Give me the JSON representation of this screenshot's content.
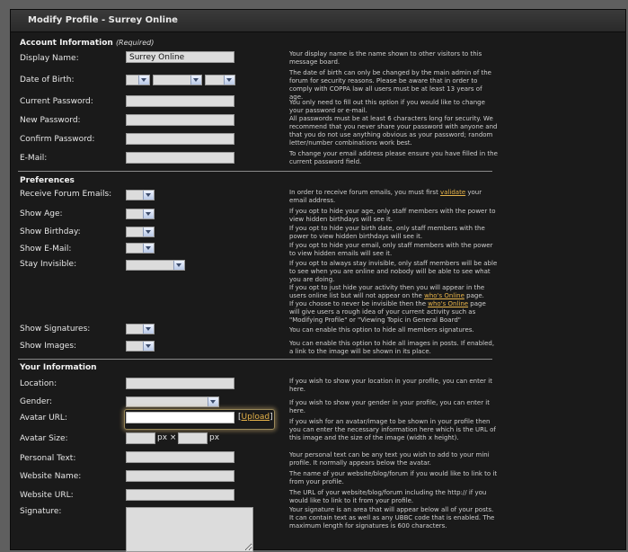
{
  "window": {
    "title": "Modify Profile - Surrey Online"
  },
  "sections": {
    "account": {
      "title": "Account Information",
      "note": "(Required)"
    },
    "preferences": {
      "title": "Preferences"
    },
    "info": {
      "title": "Your Information"
    }
  },
  "account": {
    "display_name": {
      "label": "Display Name:",
      "value": "Surrey Online",
      "help": "Your display name is the name shown to other visitors to this message board."
    },
    "dob": {
      "label": "Date of Birth:",
      "help": "The date of birth can only be changed by the main admin of the forum for security reasons. Please be aware that in order to comply with COPPA law all users must be at least 13 years of age."
    },
    "current_password": {
      "label": "Current Password:",
      "help": "You only need to fill out this option if you would like to change your password or e-mail."
    },
    "new_password": {
      "label": "New Password:",
      "help": "All passwords must be at least 6 characters long for security. We recommend that you never share your password with anyone and that you do not use anything obvious as your password; random letter/number combinations work best."
    },
    "confirm_password": {
      "label": "Confirm Password:"
    },
    "email": {
      "label": "E-Mail:",
      "help": "To change your email address please ensure you have filled in the current password field."
    }
  },
  "preferences": {
    "receive_emails": {
      "label": "Receive Forum Emails:",
      "help_before": "In order to receive forum emails, you must first ",
      "help_link": "validate",
      "help_after": " your email address."
    },
    "show_age": {
      "label": "Show Age:",
      "help": "If you opt to hide your age, only staff members with the power to view hidden birthdays will see it."
    },
    "show_birthday": {
      "label": "Show Birthday:",
      "help": "If you opt to hide your birth date, only staff members with the power to view hidden birthdays will see it."
    },
    "show_email": {
      "label": "Show E-Mail:",
      "help": "If you opt to hide your email, only staff members with the power to view hidden emails will see it."
    },
    "stay_invisible": {
      "label": "Stay Invisible:",
      "help1": "If you opt to always stay invisible, only staff members will be able to see when you are online and nobody will be able to see what you are doing.",
      "help2_before": "If you opt to just hide your activity then you will appear in the users online list but will not appear on the ",
      "help2_link": "who's Online",
      "help2_after": " page.",
      "help3_before": "If you choose to never be invisible then the ",
      "help3_link": "who's Online",
      "help3_after": " page will give users a rough idea of your current activity such as \"Modifying Profile\" or \"Viewing Topic in General Board\""
    },
    "show_signatures": {
      "label": "Show Signatures:",
      "help": "You can enable this option to hide all members signatures."
    },
    "show_images": {
      "label": "Show Images:",
      "help": "You can enable this option to hide all images in posts. If enabled, a link to the image will be shown in its place."
    }
  },
  "info": {
    "location": {
      "label": "Location:",
      "help": "If you wish to show your location in your profile, you can enter it here."
    },
    "gender": {
      "label": "Gender:",
      "help": "If you wish to show your gender in your profile, you can enter it here."
    },
    "avatar_url": {
      "label": "Avatar URL:",
      "upload_link": "Upload",
      "help": "If you wish for an avatar/image to be shown in your profile then you can enter the necessary information here which is the URL of this image and the size of the image (width x height)."
    },
    "avatar_size": {
      "label": "Avatar Size:",
      "px1": "px ×",
      "px2": "px"
    },
    "personal_text": {
      "label": "Personal Text:",
      "help": "Your personal text can be any text you wish to add to your mini profile. It normally appears below the avatar."
    },
    "website_name": {
      "label": "Website Name:",
      "help": "The name of your website/blog/forum if you would like to link to it from your profile."
    },
    "website_url": {
      "label": "Website URL:",
      "help": "The URL of your website/blog/forum including the http:// if you would like to link to it from your profile."
    },
    "signature": {
      "label": "Signature:",
      "help": "Your signature is an area that will appear below all of your posts. It can contain text as well as any UBBC code that is enabled. The maximum length for signatures is 600 characters."
    }
  },
  "colors": {
    "accent_link": "#e6b34a",
    "panel": "#1a1a1a",
    "page": "#5f5f5f"
  }
}
